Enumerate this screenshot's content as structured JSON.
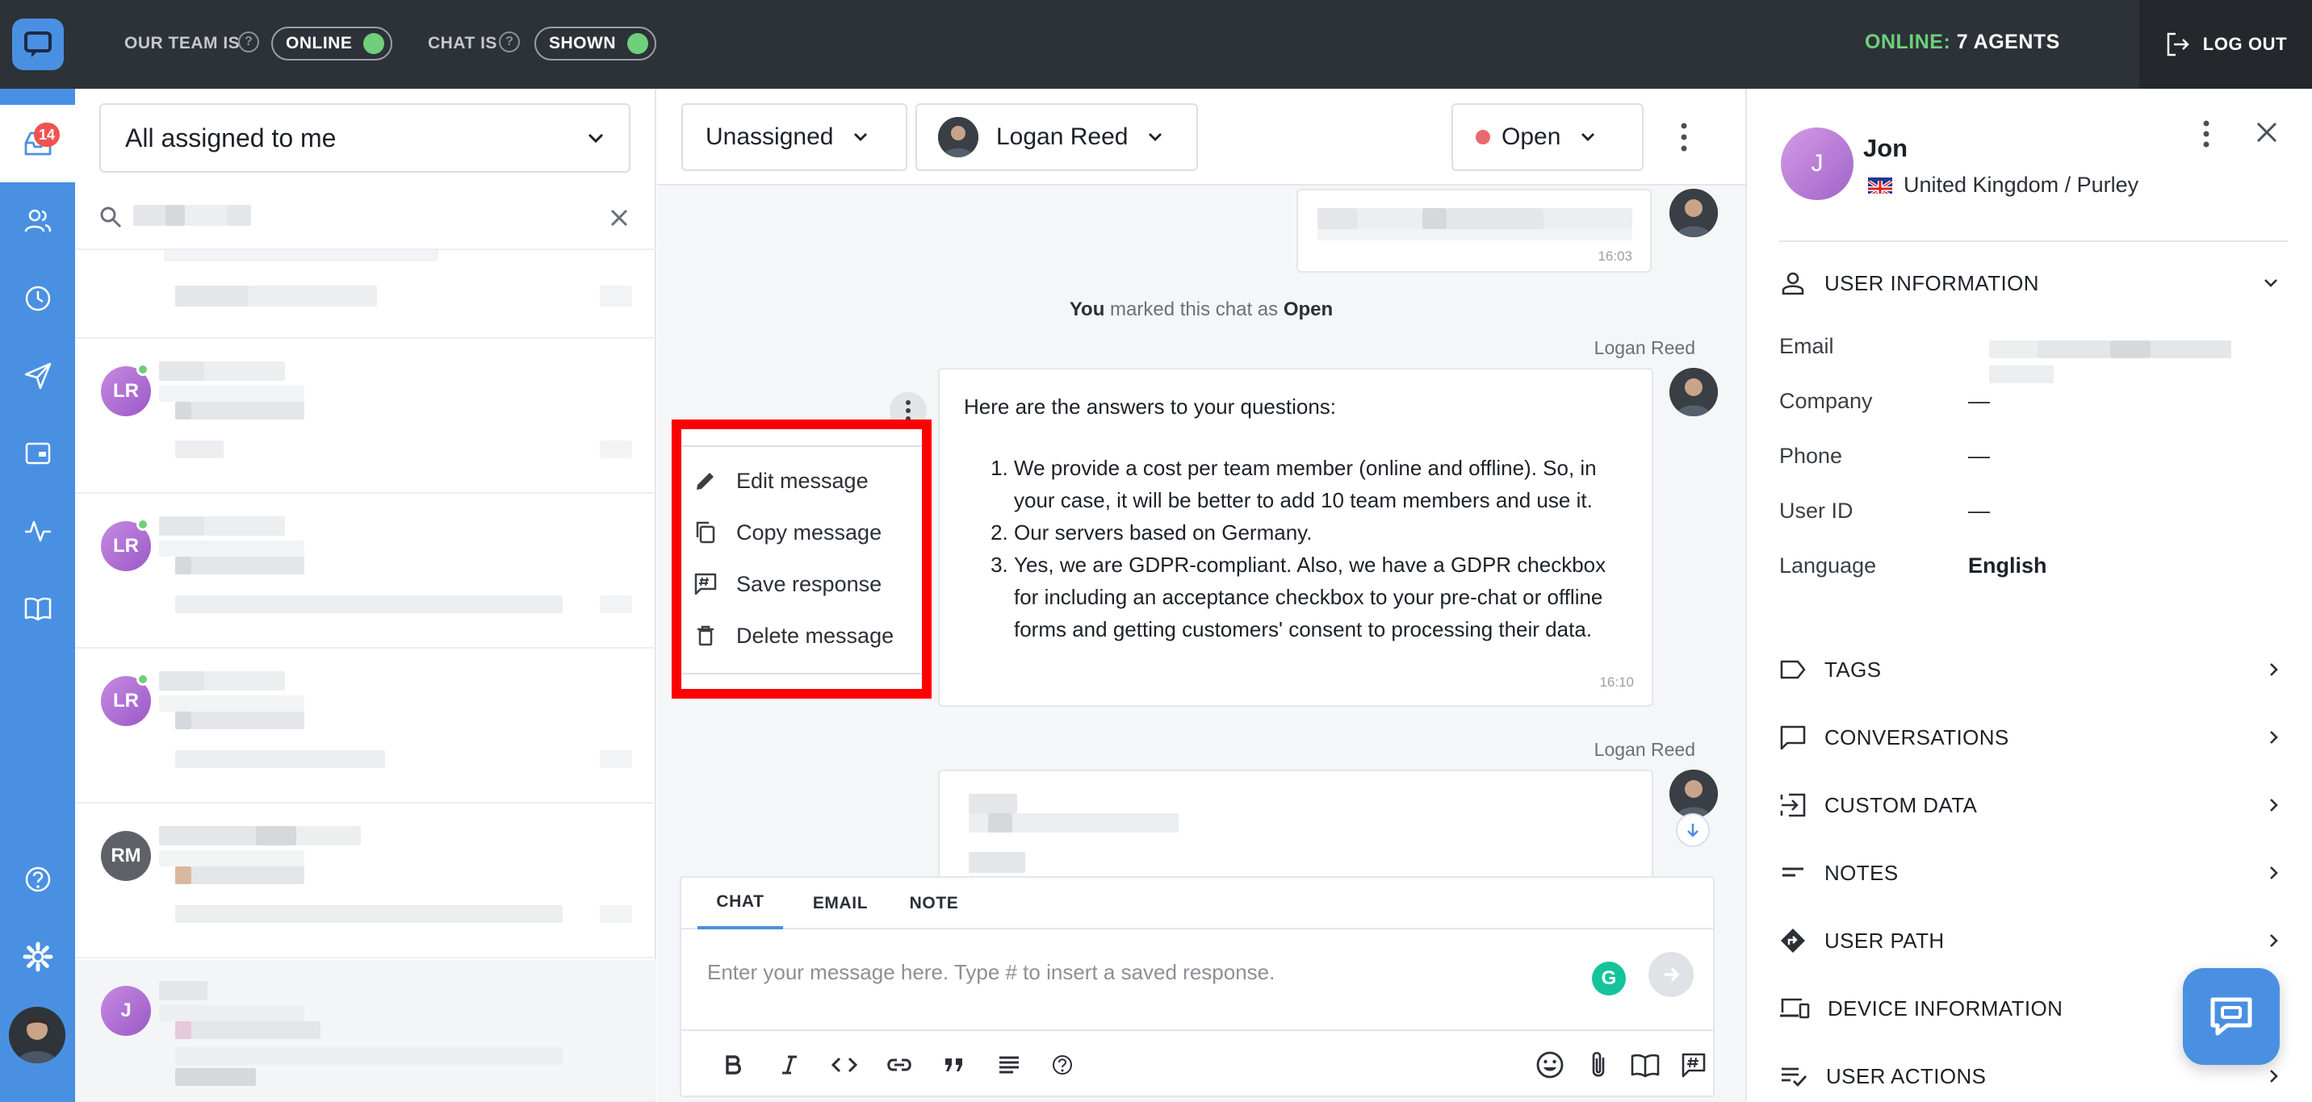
{
  "topbar": {
    "team_label": "OUR TEAM IS",
    "team_status": "ONLINE",
    "chat_label": "CHAT IS",
    "chat_status": "SHOWN",
    "online_prefix": "ONLINE:",
    "online_count": "7 AGENTS",
    "logout": "LOG OUT"
  },
  "nav": {
    "inbox_badge": "14"
  },
  "conversations": {
    "filter": "All assigned to me",
    "items": [
      {
        "initials": "LR"
      },
      {
        "initials": "LR"
      },
      {
        "initials": "LR"
      },
      {
        "initials": "RM"
      },
      {
        "initials": "J"
      }
    ]
  },
  "chat": {
    "assignee_group": "Unassigned",
    "agent": "Logan Reed",
    "status": "Open",
    "msg1_time": "16:03",
    "system_you": "You",
    "system_text": " marked this chat as ",
    "system_status": "Open",
    "author1": "Logan Reed",
    "author2": "Logan Reed",
    "intro": "Here are the answers to your questions:",
    "answers": [
      "We provide a cost per team member (online and offline). So, in your case, it will be better to add 10 team members and use it.",
      "Our servers based on Germany.",
      "Yes, we are GDPR-compliant. Also, we have a GDPR checkbox for including an acceptance checkbox to your pre-chat or offline forms and getting customers' consent to processing their data."
    ],
    "msg2_time": "16:10",
    "context_menu": [
      "Edit message",
      "Copy message",
      "Save response",
      "Delete message"
    ]
  },
  "composer": {
    "tabs": [
      "CHAT",
      "EMAIL",
      "NOTE"
    ],
    "placeholder": "Enter your message here. Type # to insert a saved response.",
    "grammarly": "G"
  },
  "user": {
    "initial": "J",
    "name": "Jon",
    "location": "United Kingdom / Purley",
    "section_info": "USER INFORMATION",
    "fields": [
      {
        "key": "Email",
        "value": ""
      },
      {
        "key": "Company",
        "value": "—"
      },
      {
        "key": "Phone",
        "value": "—"
      },
      {
        "key": "User ID",
        "value": "—"
      },
      {
        "key": "Language",
        "value": "English"
      }
    ],
    "sections": [
      "TAGS",
      "CONVERSATIONS",
      "CUSTOM DATA",
      "NOTES",
      "USER PATH",
      "DEVICE INFORMATION",
      "USER ACTIONS"
    ]
  },
  "colors": {
    "accent": "#4a90e2",
    "online": "#6fcf7a",
    "highlight": "#ff0000",
    "topbar": "#2d3238"
  }
}
